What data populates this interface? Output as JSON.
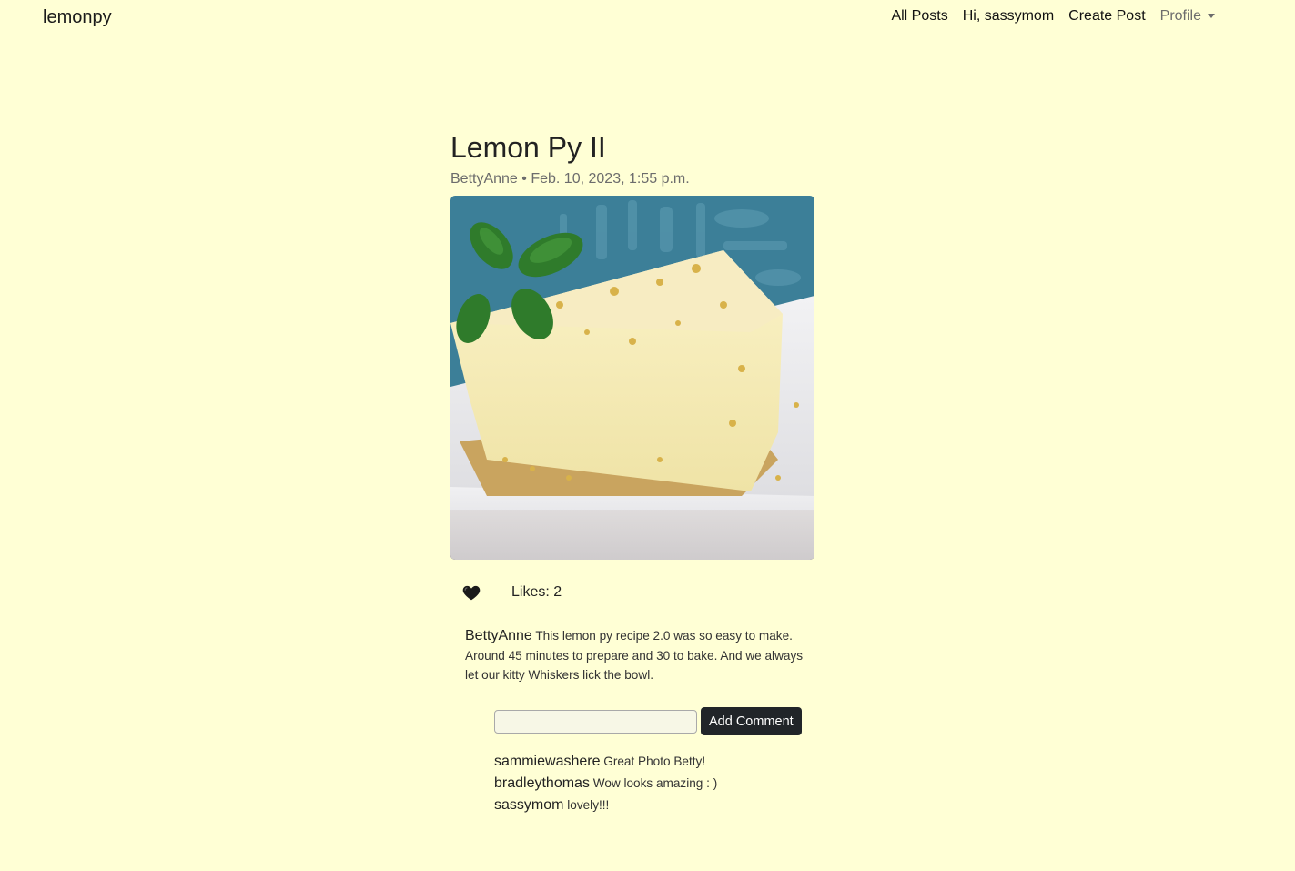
{
  "nav": {
    "brand": "lemonpy",
    "links": [
      "All Posts",
      "Hi, sassymom",
      "Create Post"
    ],
    "profile": "Profile"
  },
  "post": {
    "title": "Lemon Py II",
    "author": "BettyAnne",
    "separator": "•",
    "date": "Feb. 10, 2023, 1:55 p.m.",
    "image_alt": "Slice of lemon pie with mint garnish",
    "likes_label": "Likes: 2",
    "likes": 2,
    "caption_author": "BettyAnne",
    "caption_text": "This lemon py recipe 2.0 was so easy to make. Around 45 minutes to prepare and 30 to bake. And we always let our kitty Whiskers lick the bowl."
  },
  "comment_form": {
    "input_value": "",
    "button_label": "Add Comment"
  },
  "comments": [
    {
      "user": "sammiewashere",
      "text": "Great Photo Betty!"
    },
    {
      "user": "bradleythomas",
      "text": "Wow looks amazing : )"
    },
    {
      "user": "sassymom",
      "text": "lovely!!!"
    }
  ],
  "colors": {
    "background": "#ffffd5",
    "button": "#212529",
    "heart": "#1a1a1a"
  }
}
